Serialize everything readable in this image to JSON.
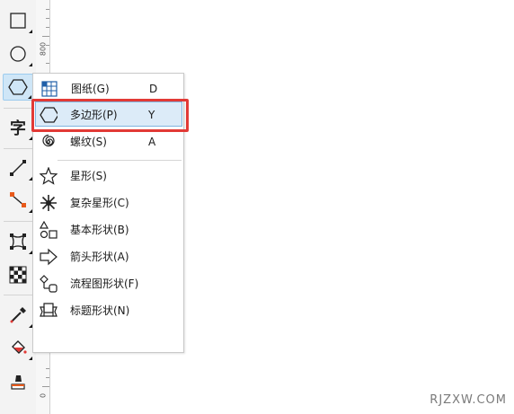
{
  "toolbox": {
    "tools": [
      {
        "name": "rectangle-tool",
        "icon": "rectangle-icon"
      },
      {
        "name": "ellipse-tool",
        "icon": "ellipse-icon"
      },
      {
        "name": "polygon-tool",
        "icon": "hexagon-icon",
        "active": true
      },
      {
        "name": "text-tool",
        "icon": "text-icon",
        "glyph": "字"
      },
      {
        "name": "line-tool",
        "icon": "line-icon"
      },
      {
        "name": "connector-tool",
        "icon": "connector-icon"
      },
      {
        "name": "envelope-tool",
        "icon": "envelope-distort-icon"
      },
      {
        "name": "transparency-tool",
        "icon": "checker-icon"
      },
      {
        "name": "eyedropper-tool",
        "icon": "eyedropper-icon"
      },
      {
        "name": "fill-tool",
        "icon": "paint-bucket-icon"
      },
      {
        "name": "smart-fill-tool",
        "icon": "smart-fill-icon"
      }
    ]
  },
  "ruler": {
    "label_top": "800",
    "label_bottom": "0"
  },
  "menu": {
    "items": [
      {
        "label": "图纸(G)",
        "key": "D",
        "icon": "graph-paper-icon"
      },
      {
        "label": "多边形(P)",
        "key": "Y",
        "icon": "hexagon-icon",
        "highlighted": true
      },
      {
        "label": "螺纹(S)",
        "key": "A",
        "icon": "spiral-icon"
      },
      {
        "label": "星形(S)",
        "key": "",
        "icon": "star-icon"
      },
      {
        "label": "复杂星形(C)",
        "key": "",
        "icon": "complex-star-icon"
      },
      {
        "label": "基本形状(B)",
        "key": "",
        "icon": "basic-shapes-icon"
      },
      {
        "label": "箭头形状(A)",
        "key": "",
        "icon": "arrow-shape-icon"
      },
      {
        "label": "流程图形状(F)",
        "key": "",
        "icon": "flowchart-icon"
      },
      {
        "label": "标题形状(N)",
        "key": "",
        "icon": "banner-icon"
      }
    ]
  },
  "colors": {
    "highlight_bg": "#dcebf8",
    "highlight_border": "#7fb4df",
    "annotation_red": "#e23a36"
  },
  "watermark": "RJZXW.COM"
}
